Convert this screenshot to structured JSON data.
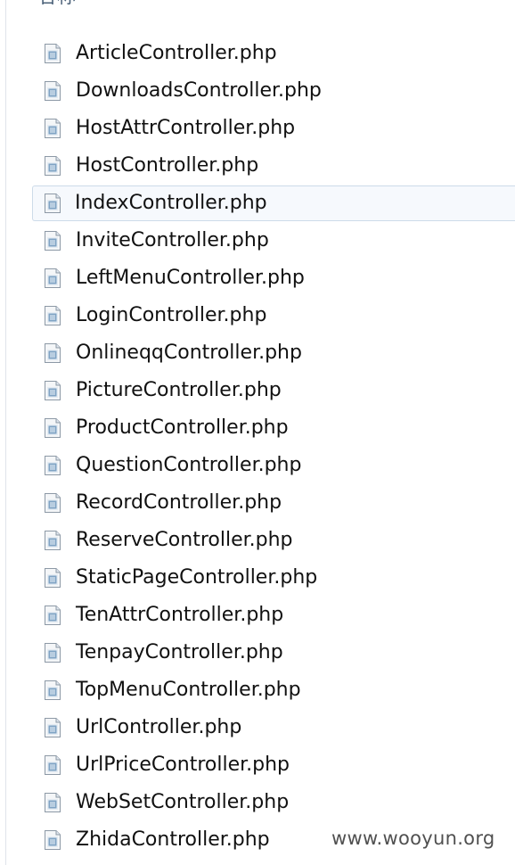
{
  "header": {
    "name_column": "名称"
  },
  "files": [
    {
      "name": "ArticleController.php",
      "selected": false
    },
    {
      "name": "DownloadsController.php",
      "selected": false
    },
    {
      "name": "HostAttrController.php",
      "selected": false
    },
    {
      "name": "HostController.php",
      "selected": false
    },
    {
      "name": "IndexController.php",
      "selected": true
    },
    {
      "name": "InviteController.php",
      "selected": false
    },
    {
      "name": "LeftMenuController.php",
      "selected": false
    },
    {
      "name": "LoginController.php",
      "selected": false
    },
    {
      "name": "OnlineqqController.php",
      "selected": false
    },
    {
      "name": "PictureController.php",
      "selected": false
    },
    {
      "name": "ProductController.php",
      "selected": false
    },
    {
      "name": "QuestionController.php",
      "selected": false
    },
    {
      "name": "RecordController.php",
      "selected": false
    },
    {
      "name": "ReserveController.php",
      "selected": false
    },
    {
      "name": "StaticPageController.php",
      "selected": false
    },
    {
      "name": "TenAttrController.php",
      "selected": false
    },
    {
      "name": "TenpayController.php",
      "selected": false
    },
    {
      "name": "TopMenuController.php",
      "selected": false
    },
    {
      "name": "UrlController.php",
      "selected": false
    },
    {
      "name": "UrlPriceController.php",
      "selected": false
    },
    {
      "name": "WebSetController.php",
      "selected": false
    },
    {
      "name": "ZhidaController.php",
      "selected": false
    }
  ],
  "icon": "php-file-icon",
  "watermark": "www.wooyun.org",
  "colors": {
    "selection_fill": "#f6f9fd",
    "selection_border": "#cddbe9",
    "header_text": "#4a6078"
  }
}
